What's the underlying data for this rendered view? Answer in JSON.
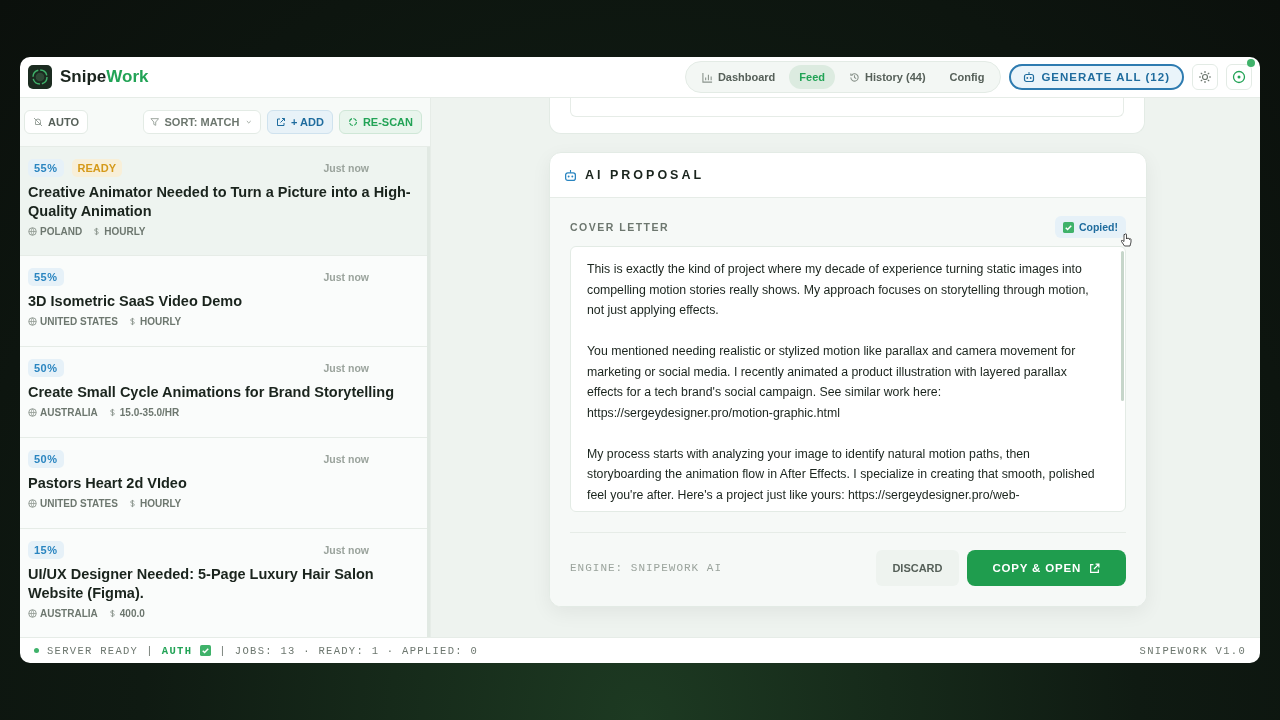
{
  "app": {
    "brand_first": "Snipe",
    "brand_second": "Work"
  },
  "nav": [
    {
      "label": "Dashboard",
      "kind": "chart",
      "selected": false
    },
    {
      "label": "Feed",
      "kind": "plain",
      "selected": true
    },
    {
      "label": "History (44)",
      "kind": "history",
      "selected": false
    },
    {
      "label": "Config",
      "kind": "plain",
      "selected": false
    }
  ],
  "generate_button": "GENERATE ALL (12)",
  "toolbar": {
    "auto": "AUTO",
    "sort": "SORT: MATCH",
    "add": "+ ADD",
    "rescan": "RE-SCAN"
  },
  "jobs": [
    {
      "match": "55%",
      "status": "READY",
      "time": "Just now",
      "title": "Creative Animator Needed to Turn a Picture into a High-Quality Animation",
      "location": "POLAND",
      "pay": "HOURLY",
      "selected": true
    },
    {
      "match": "55%",
      "time": "Just now",
      "title": "3D Isometric SaaS Video Demo",
      "location": "UNITED STATES",
      "pay": "HOURLY",
      "selected": false
    },
    {
      "match": "50%",
      "time": "Just now",
      "title": "Create Small Cycle Animations for Brand Storytelling",
      "location": "AUSTRALIA",
      "pay": "15.0-35.0/HR",
      "selected": false
    },
    {
      "match": "50%",
      "time": "Just now",
      "title": "Pastors Heart 2d VIdeo",
      "location": "UNITED STATES",
      "pay": "HOURLY",
      "selected": false
    },
    {
      "match": "15%",
      "time": "Just now",
      "title": "UI/UX Designer Needed: 5-Page Luxury Hair Salon Website (Figma).",
      "location": "AUSTRALIA",
      "pay": "400.0",
      "selected": false
    }
  ],
  "proposal": {
    "title": "AI PROPOSAL",
    "label": "COVER LETTER",
    "copied": "Copied!",
    "paragraphs": [
      "This is exactly the kind of project where my decade of experience turning static images into compelling motion stories really shows. My approach focuses on storytelling through motion, not just applying effects.",
      "You mentioned needing realistic or stylized motion like parallax and camera movement for marketing or social media. I recently animated a product illustration with layered parallax effects for a tech brand's social campaign. See similar work here: https://sergeydesigner.pro/motion-graphic.html",
      "My process starts with analyzing your image to identify natural motion paths, then storyboarding the animation flow in After Effects. I specialize in creating that smooth, polished feel you're after. Here's a project just like yours: https://sergeydesigner.pro/web-"
    ],
    "engine": "ENGINE: SNIPEWORK AI",
    "discard": "DISCARD",
    "copy_open": "COPY & OPEN"
  },
  "status_bar": {
    "server": "SERVER READY",
    "sep1": "|",
    "auth": "AUTH",
    "sep2": "|",
    "counts": "JOBS: 13 · READY: 1 · APPLIED: 0",
    "version": "SNIPEWORK V1.0"
  }
}
